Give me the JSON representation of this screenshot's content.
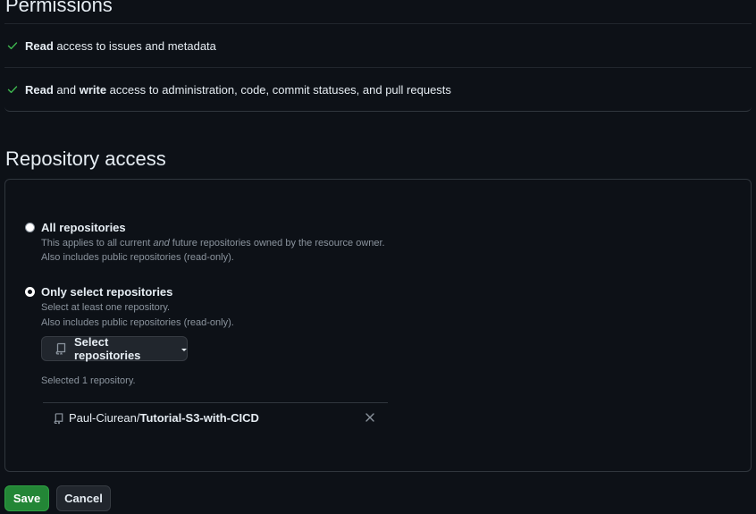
{
  "permissions": {
    "heading": "Permissions",
    "items": [
      {
        "parts": [
          {
            "bold": "Read"
          },
          {
            "text": " access to issues and metadata"
          }
        ]
      },
      {
        "parts": [
          {
            "bold": "Read"
          },
          {
            "text": " and "
          },
          {
            "bold": "write"
          },
          {
            "text": " access to administration, code, commit statuses, and pull requests"
          }
        ]
      }
    ],
    "icon": "check-icon",
    "check_color": "#3fb950"
  },
  "repository_access": {
    "heading": "Repository access",
    "all": {
      "label": "All repositories",
      "note1_pre": "This applies to all current ",
      "note1_em": "and",
      "note1_post": " future repositories owned by the resource owner.",
      "note2": "Also includes public repositories (read-only).",
      "checked": false
    },
    "select": {
      "label": "Only select repositories",
      "note1": "Select at least one repository.",
      "note2": "Also includes public repositories (read-only).",
      "checked": true
    },
    "select_button": {
      "label": "Select repositories",
      "icon": "repo-icon"
    },
    "selected_count": "Selected 1 repository.",
    "selected_repos": [
      {
        "owner": "Paul-Ciurean/",
        "repo": "Tutorial-S3-with-CICD",
        "icon": "repo-icon",
        "remove_icon": "close-icon"
      }
    ]
  },
  "actions": {
    "save": "Save",
    "cancel": "Cancel"
  },
  "colors": {
    "background": "#0d1117",
    "accent_green": "#238636",
    "border": "#30363d",
    "muted": "#8b949e"
  }
}
